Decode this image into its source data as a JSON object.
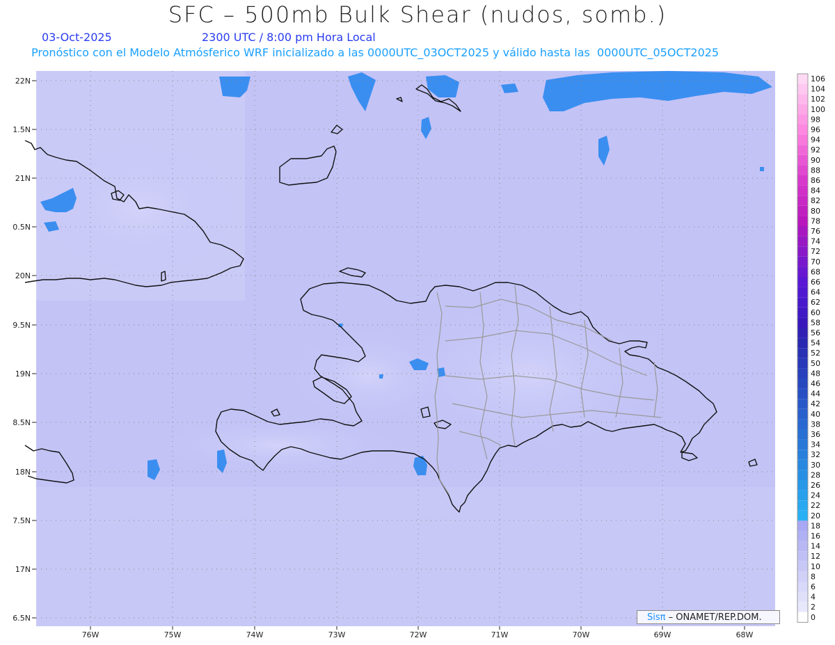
{
  "header": {
    "title": "SFC – 500mb Bulk Shear (nudos, somb.)",
    "date": "03-Oct-2025",
    "time": "2300 UTC / 8:00 pm Hora Local",
    "info": "Pronóstico con el Modelo Atmósferico WRF inicializado a las 0000UTC_03OCT2025 y válido hasta las  0000UTC_05OCT2025"
  },
  "axes": {
    "lat_labels": [
      "22N",
      "1.5N",
      "21N",
      "0.5N",
      "20N",
      "9.5N",
      "19N",
      "8.5N",
      "18N",
      "7.5N",
      "17N",
      "6.5N"
    ],
    "lon_labels": [
      "76W",
      "75W",
      "74W",
      "73W",
      "72W",
      "71W",
      "70W",
      "69W",
      "68W"
    ]
  },
  "colorbar": {
    "labels": [
      "106",
      "104",
      "102",
      "100",
      "98",
      "96",
      "94",
      "92",
      "90",
      "88",
      "86",
      "84",
      "82",
      "80",
      "78",
      "76",
      "74",
      "72",
      "70",
      "68",
      "66",
      "64",
      "62",
      "60",
      "58",
      "56",
      "54",
      "52",
      "50",
      "48",
      "46",
      "44",
      "42",
      "40",
      "38",
      "36",
      "34",
      "32",
      "30",
      "28",
      "26",
      "24",
      "22",
      "20",
      "18",
      "16",
      "14",
      "12",
      "10",
      "8",
      "6",
      "4",
      "2",
      "0"
    ],
    "colors": [
      "#ffd8f4",
      "#ffc8f0",
      "#ffb8ec",
      "#ffa8e8",
      "#ff98e4",
      "#ff88e0",
      "#f878dc",
      "#f068d8",
      "#e858d4",
      "#e048d0",
      "#d838cc",
      "#d030c8",
      "#c828c4",
      "#c020c0",
      "#b818bc",
      "#a818c0",
      "#9818c4",
      "#8818c8",
      "#7818cc",
      "#6818d0",
      "#5818d4",
      "#5018d0",
      "#4818cc",
      "#4018c4",
      "#3818bc",
      "#3020b4",
      "#2828b0",
      "#2830b4",
      "#2838b8",
      "#2840bc",
      "#2848c0",
      "#2850c4",
      "#2858c8",
      "#2860cc",
      "#2868d0",
      "#2870d4",
      "#2878d8",
      "#2880dc",
      "#2888e0",
      "#2890e4",
      "#2898e8",
      "#28a0ec",
      "#28a8f0",
      "#28b0f4",
      "#a8a8f4",
      "#b0b0f4",
      "#b8b8f4",
      "#c0c0f6",
      "#c8c8f6",
      "#d0d0f8",
      "#d8d8fa",
      "#e0e0fb",
      "#e8e8fd",
      "#ffffff"
    ]
  },
  "credit": {
    "logo": "Sisπ",
    "text": "– ONAMET/REP.DOM."
  },
  "colors": {
    "ocean": "#c2c2f8",
    "shear_highlight": "#3a8ef0"
  }
}
